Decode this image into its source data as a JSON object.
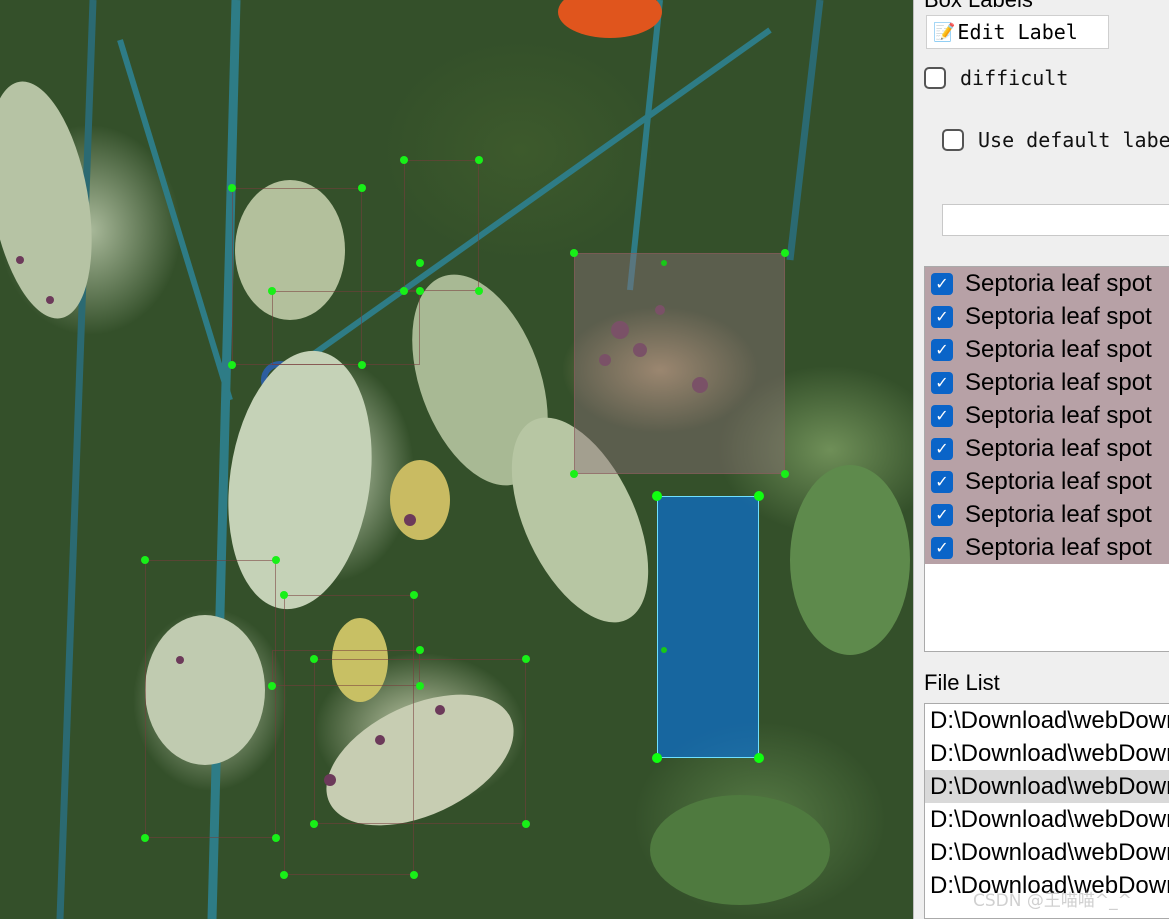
{
  "box_labels": {
    "title": "Box Labels",
    "edit_label": "Edit Label",
    "difficult": "difficult",
    "use_default_label": "Use default label",
    "default_label_value": ""
  },
  "labels": [
    "Septoria leaf spot",
    "Septoria leaf spot",
    "Septoria leaf spot",
    "Septoria leaf spot",
    "Septoria leaf spot",
    "Septoria leaf spot",
    "Septoria leaf spot",
    "Septoria leaf spot",
    "Septoria leaf spot"
  ],
  "file_list": {
    "title": "File List",
    "items": [
      "D:\\Download\\webDownload",
      "D:\\Download\\webDownload",
      "D:\\Download\\webDownload",
      "D:\\Download\\webDownload",
      "D:\\Download\\webDownload",
      "D:\\Download\\webDownload"
    ],
    "selected_index": 2
  },
  "watermark": "CSDN @王喵喵^_^",
  "colors": {
    "bbox_point": "#18f018",
    "selected_box_fill": "#0078ff",
    "label_row_bg": "#b7a1a6",
    "checkbox_blue": "#0a64c8"
  }
}
